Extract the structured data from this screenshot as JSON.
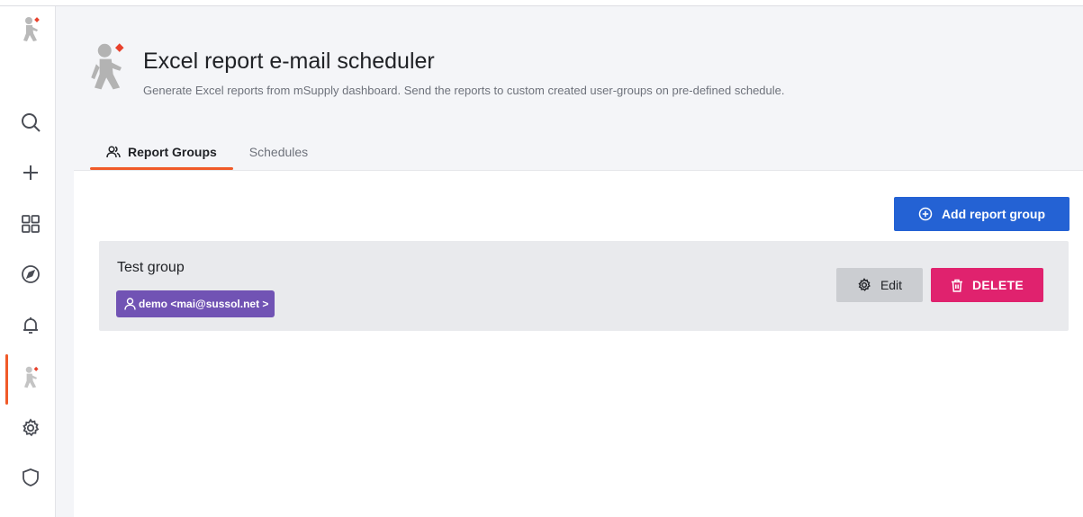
{
  "colors": {
    "accent": "#f05a28",
    "primary_button": "#2462d4",
    "danger_button": "#e0226e",
    "member_tag": "#7153b4",
    "secondary_button": "#cbcdd1"
  },
  "sidebar": {
    "items": [
      {
        "name": "home-logo",
        "icon": "msupply-runner-icon"
      },
      {
        "name": "search",
        "icon": "search-icon"
      },
      {
        "name": "create",
        "icon": "plus-icon"
      },
      {
        "name": "dashboards",
        "icon": "grid-icon"
      },
      {
        "name": "explore",
        "icon": "compass-icon"
      },
      {
        "name": "alerting",
        "icon": "bell-icon"
      },
      {
        "name": "report-scheduler",
        "icon": "msupply-runner-icon",
        "active": true
      },
      {
        "name": "configuration",
        "icon": "gear-icon"
      },
      {
        "name": "server-admin",
        "icon": "shield-icon"
      }
    ]
  },
  "header": {
    "title": "Excel report e-mail scheduler",
    "subtitle": "Generate Excel reports from mSupply dashboard. Send the reports to custom created user-groups on pre-defined schedule."
  },
  "tabs": [
    {
      "label": "Report Groups",
      "icon": "users-icon",
      "active": true
    },
    {
      "label": "Schedules",
      "active": false
    }
  ],
  "toolbar": {
    "add_label": "Add report group",
    "add_icon": "plus-circle-icon"
  },
  "groups": [
    {
      "name": "Test group",
      "members": [
        "demo <mai@sussol.net >"
      ],
      "edit_label": "Edit",
      "delete_label": "DELETE"
    }
  ]
}
